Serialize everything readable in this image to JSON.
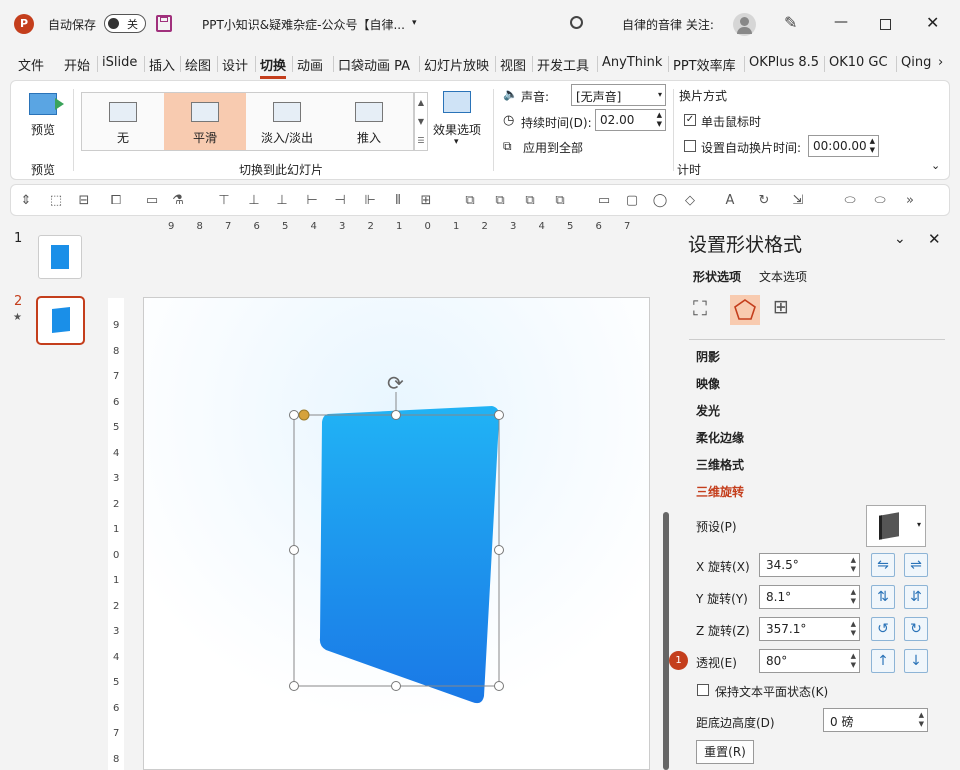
{
  "titlebar": {
    "autosave_label": "自动保存",
    "toggle_state": "关",
    "doc_title": "PPT小知识&疑难杂症-公众号【自律...",
    "user_label": "自律的音律 关注:"
  },
  "tabs": [
    "文件",
    "开始",
    "iSlide",
    "插入",
    "绘图",
    "设计",
    "切换",
    "动画",
    "口袋动画 PA",
    "幻灯片放映",
    "视图",
    "开发工具",
    "AnyThink",
    "PPT效率库",
    "OKPlus 8.5",
    "OK10 GC",
    "Qing"
  ],
  "active_tab": "切换",
  "ribbon": {
    "preview_label": "预览",
    "preview_group_label": "预览",
    "transitions": [
      "无",
      "平滑",
      "淡入/淡出",
      "推入"
    ],
    "selected_transition": "平滑",
    "effect_options_label": "效果选项",
    "group_label": "切换到此幻灯片",
    "sound_label": "声音:",
    "sound_value": "[无声音]",
    "duration_label": "持续时间(D):",
    "duration_value": "02.00",
    "apply_all_label": "应用到全部",
    "advance_label": "换片方式",
    "on_click_label": "单击鼠标时",
    "on_click_checked": true,
    "after_label": "设置自动换片时间:",
    "after_value": "00:00.00",
    "after_checked": false,
    "timing_group_label": "计时"
  },
  "slides": [
    {
      "number": "1",
      "star": ""
    },
    {
      "number": "2",
      "star": "★"
    }
  ],
  "ruler_h": [
    "9",
    "8",
    "7",
    "6",
    "5",
    "4",
    "3",
    "2",
    "1",
    "0",
    "1",
    "2",
    "3",
    "4",
    "5",
    "6",
    "7"
  ],
  "ruler_v": [
    "9",
    "8",
    "7",
    "6",
    "5",
    "4",
    "3",
    "2",
    "1",
    "0",
    "1",
    "2",
    "3",
    "4",
    "5",
    "6",
    "7",
    "8"
  ],
  "panel": {
    "title": "设置形状格式",
    "tab_shape": "形状选项",
    "tab_text": "文本选项",
    "sections": [
      "阴影",
      "映像",
      "发光",
      "柔化边缘",
      "三维格式",
      "三维旋转"
    ],
    "active_section": "三维旋转",
    "preset_label": "预设(P)",
    "x_label": "X 旋转(X)",
    "x_value": "34.5°",
    "y_label": "Y 旋转(Y)",
    "y_value": "8.1°",
    "z_label": "Z 旋转(Z)",
    "z_value": "357.1°",
    "persp_label": "透视(E)",
    "persp_value": "80°",
    "badge": "1",
    "keep_flat_label": "保持文本平面状态(K)",
    "dist_label": "距底边高度(D)",
    "dist_value": "0 磅",
    "reset_label": "重置(R)"
  },
  "colors": {
    "accent": "#c43e1c",
    "shape_top": "#1ea8f2",
    "shape_bottom": "#1a7ee8"
  }
}
